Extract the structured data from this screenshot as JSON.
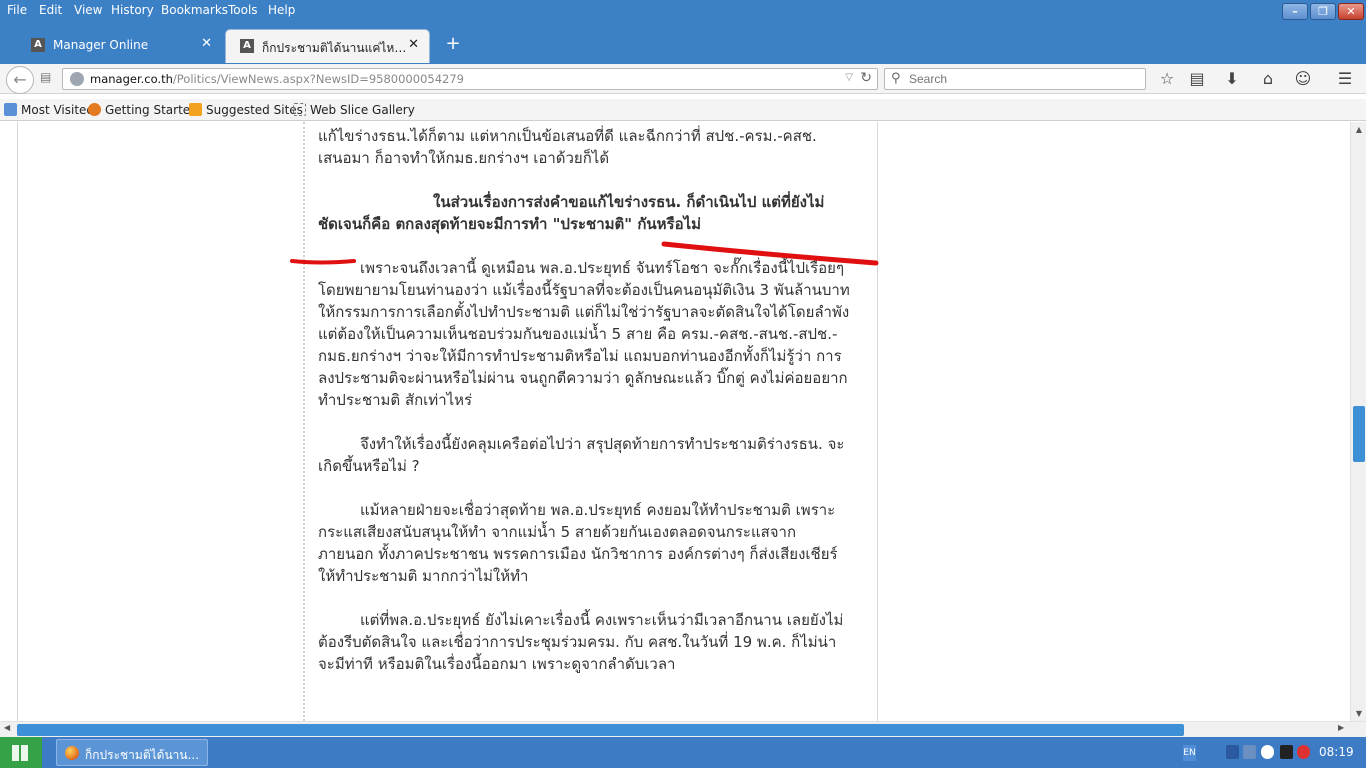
{
  "menu": [
    "File",
    "Edit",
    "View",
    "History",
    "Bookmarks",
    "Tools",
    "Help"
  ],
  "tabs": [
    {
      "title": "Manager Online",
      "active": false
    },
    {
      "title": "ก็กประชามติได้นานแค่ไหน ? - ...",
      "active": true
    }
  ],
  "nav": {
    "url_host": "manager.co.th",
    "url_path": "/Politics/ViewNews.aspx?NewsID=9580000054279",
    "search_placeholder": "Search"
  },
  "bookmarks": [
    "Most Visited",
    "Getting Started",
    "Suggested Sites",
    "Web Slice Gallery"
  ],
  "article": {
    "p0": "แก้ไขร่างรธน.ได้ก็ตาม แต่หากเป็นข้อเสนอที่ดี และฉีกกว่าที่ สปช.-ครม.-คสช. เสนอมา ก็อาจทำให้กมธ.ยกร่างฯ เอาด้วยก็ได้",
    "p1": "ในส่วนเรื่องการส่งคำขอแก้ไขร่างรธน. ก็ดำเนินไป แต่ที่ยังไม่ชัดเจนก็คือ ตกลงสุดท้ายจะมีการทำ \"ประชามติ\" กันหรือไม่",
    "p2": "เพราะจนถึงเวลานี้ ดูเหมือน พล.อ.ประยุทธ์ จันทร์โอชา จะกั๊กเรื่องนี้ไปเรื่อยๆ โดยพยายามโยนท่านองว่า แม้เรื่องนี้รัฐบาลที่จะต้องเป็นคนอนุมัติเงิน 3 พันล้านบาท ให้กรรมการการเลือกตั้งไปทำประชามติ แต่ก็ไม่ใช่ว่ารัฐบาลจะตัดสินใจได้โดยลำพัง แต่ต้องให้เป็นความเห็นชอบร่วมกันของแม่น้ำ 5 สาย คือ ครม.-คสช.-สนช.-สปช.-กมธ.ยกร่างฯ ว่าจะให้มีการทำประชามติหรือไม่ แถมบอกท่านองอีกทั้งก็ไม่รู้ว่า การลงประชามติจะผ่านหรือไม่ผ่าน จนถูกตีความว่า ดูลักษณะแล้ว บิ๊กตู่ คงไม่ค่อยอยากทำประชามติ สักเท่าไหร่",
    "p3": "จึงทำให้เรื่องนี้ยังคลุมเครือต่อไปว่า สรุปสุดท้ายการทำประชามติร่างรธน. จะเกิดขึ้นหรือไม่ ?",
    "p4": "แม้หลายฝ่ายจะเชื่อว่าสุดท้าย พล.อ.ประยุทธ์ คงยอมให้ทำประชามติ เพราะกระแสเสียงสนับสนุนให้ทำ จากแม่น้ำ 5 สายด้วยกันเองตลอดจนกระแสจากภายนอก ทั้งภาคประชาชน พรรคการเมือง นักวิชาการ องค์กรต่างๆ ก็ส่งเสียงเชียร์ให้ทำประชามติ มากกว่าไม่ให้ทำ",
    "p5": "แต่ที่พล.อ.ประยุทธ์ ยังไม่เคาะเรื่องนี้ คงเพราะเห็นว่ามีเวลาอีกนาน เลยยังไม่ต้องรีบตัดสินใจ และเชื่อว่าการประชุมร่วมครม. กับ คสช.ในวันที่ 19 พ.ค. ก็ไม่น่าจะมีท่าที หรือมติในเรื่องนี้ออกมา เพราะดูจากลำดับเวลา"
  },
  "taskbar": {
    "task_label": "ก็กประชามติได้นาน...",
    "lang": "EN",
    "clock": "08:19"
  }
}
